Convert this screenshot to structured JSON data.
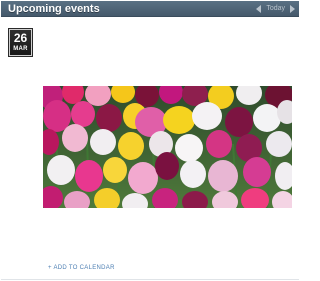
{
  "header": {
    "title": "Upcoming events",
    "today_label": "Today",
    "prev_icon": "chevron-left-icon",
    "next_icon": "chevron-right-icon"
  },
  "event": {
    "day": "26",
    "month": "MAR",
    "image_subject": "tulips"
  },
  "actions": {
    "add_to_calendar": "+ ADD TO CALENDAR"
  },
  "colors": {
    "header_bg": "#4f6578",
    "link": "#4d7fb3",
    "badge_bg": "#1e1e1e"
  }
}
